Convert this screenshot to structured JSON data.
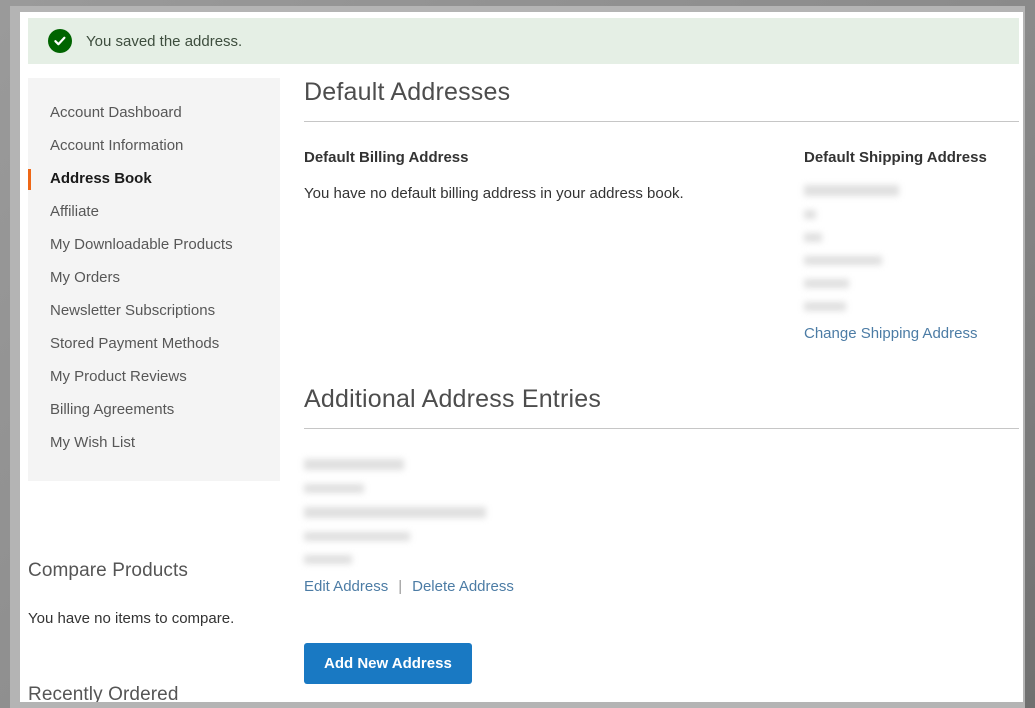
{
  "banner": {
    "icon": "check-circle-icon",
    "message": "You saved the address.",
    "background": "#e5efe5",
    "icon_color": "#006400"
  },
  "sidebar": {
    "active_index": 2,
    "accent_color": "#ee6716",
    "items": [
      {
        "label": "Account Dashboard"
      },
      {
        "label": "Account Information"
      },
      {
        "label": "Address Book"
      },
      {
        "label": "Affiliate"
      },
      {
        "label": "My Downloadable Products"
      },
      {
        "label": "My Orders"
      },
      {
        "label": "Newsletter Subscriptions"
      },
      {
        "label": "Stored Payment Methods"
      },
      {
        "label": "My Product Reviews"
      },
      {
        "label": "Billing Agreements"
      },
      {
        "label": "My Wish List"
      }
    ]
  },
  "compare": {
    "title": "Compare Products",
    "empty_text": "You have no items to compare."
  },
  "recently_ordered": {
    "title": "Recently Ordered"
  },
  "main": {
    "default_addresses": {
      "title": "Default Addresses",
      "billing": {
        "heading": "Default Billing Address",
        "empty_text": "You have no default billing address in your address book."
      },
      "shipping": {
        "heading": "Default Shipping Address",
        "redacted_line_widths": [
          95,
          12,
          18,
          78,
          45,
          42
        ],
        "change_link": "Change Shipping Address"
      }
    },
    "additional_addresses": {
      "title": "Additional Address Entries",
      "entries": [
        {
          "redacted_line_widths": [
            100,
            60,
            182,
            106,
            48
          ],
          "edit_link": "Edit Address",
          "separator": "|",
          "delete_link": "Delete Address"
        }
      ],
      "add_button": "Add New Address",
      "add_button_color": "#1979c3"
    }
  },
  "colors": {
    "link": "#4c7ca5",
    "heading": "#4d4d4d",
    "sidebar_bg": "#f4f4f4"
  }
}
